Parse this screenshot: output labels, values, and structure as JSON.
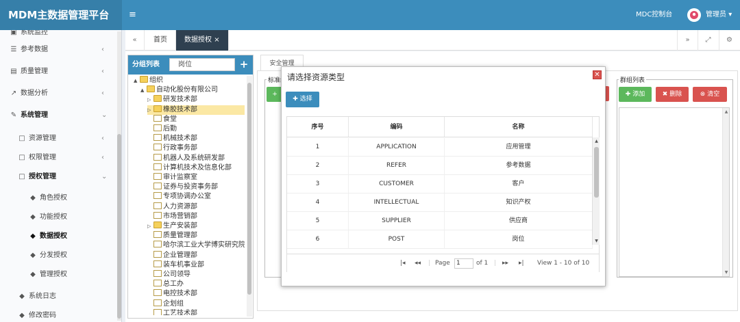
{
  "app": {
    "title": "MDM主数据管理平台",
    "menu_toggle_icon": "bars-icon"
  },
  "header": {
    "console_link": "MDC控制台",
    "user_name": "管理员",
    "user_caret": "▾"
  },
  "sidebar": {
    "items": [
      {
        "label": "参考数据",
        "icon": "list-icon"
      },
      {
        "label": "质量管理",
        "icon": "list-alt-icon"
      },
      {
        "label": "数据分析",
        "icon": "line-chart-icon"
      },
      {
        "label": "系统管理",
        "icon": "wrench-icon"
      },
      {
        "label": "资源管理",
        "icon": "folder-icon"
      },
      {
        "label": "权限管理",
        "icon": "folder-icon"
      },
      {
        "label": "授权管理",
        "icon": "folder-icon"
      },
      {
        "label": "角色授权",
        "icon": "bookmark-icon"
      },
      {
        "label": "功能授权",
        "icon": "bookmark-icon"
      },
      {
        "label": "数据授权",
        "icon": "bookmark-icon"
      },
      {
        "label": "分发授权",
        "icon": "bookmark-icon"
      },
      {
        "label": "管理授权",
        "icon": "bookmark-icon"
      },
      {
        "label": "系统日志",
        "icon": "bookmark-icon"
      },
      {
        "label": "修改密码",
        "icon": "bookmark-icon"
      }
    ],
    "partial_top_label": "系统监控"
  },
  "tabs": {
    "home": "首页",
    "active": "数据授权",
    "close_glyph": "×"
  },
  "group_list": {
    "title": "分组列表",
    "search_value": "岗位",
    "add_glyph": "+"
  },
  "tree": [
    {
      "label": "组织",
      "level": 0,
      "type": "folder",
      "toggle": "▲"
    },
    {
      "label": "自动化股份有限公司",
      "level": 1,
      "type": "folder",
      "toggle": "▲"
    },
    {
      "label": "研发技术部",
      "level": 2,
      "type": "folder",
      "toggle": "▷"
    },
    {
      "label": "橡胶技术部",
      "level": 2,
      "type": "folder",
      "toggle": "▷",
      "selected": true
    },
    {
      "label": "食堂",
      "level": 2,
      "type": "doc"
    },
    {
      "label": "后勤",
      "level": 2,
      "type": "doc"
    },
    {
      "label": "机械技术部",
      "level": 2,
      "type": "doc"
    },
    {
      "label": "行政事务部",
      "level": 2,
      "type": "doc"
    },
    {
      "label": "机器人及系统研发部",
      "level": 2,
      "type": "doc"
    },
    {
      "label": "计算机技术及信息化部",
      "level": 2,
      "type": "doc"
    },
    {
      "label": "审计监察室",
      "level": 2,
      "type": "doc"
    },
    {
      "label": "证券与投资事务部",
      "level": 2,
      "type": "doc"
    },
    {
      "label": "专项协调办公室",
      "level": 2,
      "type": "doc"
    },
    {
      "label": "人力资源部",
      "level": 2,
      "type": "doc"
    },
    {
      "label": "市场营销部",
      "level": 2,
      "type": "doc"
    },
    {
      "label": "生产安装部",
      "level": 2,
      "type": "folder",
      "toggle": "▷"
    },
    {
      "label": "质量管理部",
      "level": 2,
      "type": "doc"
    },
    {
      "label": "哈尔滨工业大学博实研究院",
      "level": 2,
      "type": "doc"
    },
    {
      "label": "企业管理部",
      "level": 2,
      "type": "doc"
    },
    {
      "label": "装车机事业部",
      "level": 2,
      "type": "doc"
    },
    {
      "label": "公司领导",
      "level": 2,
      "type": "doc"
    },
    {
      "label": "总工办",
      "level": 2,
      "type": "doc"
    },
    {
      "label": "电控技术部",
      "level": 2,
      "type": "doc"
    },
    {
      "label": "企划组",
      "level": 2,
      "type": "doc"
    },
    {
      "label": "工艺技术部",
      "level": 2,
      "type": "doc"
    }
  ],
  "security": {
    "tab_label": "安全管理",
    "standard_legend": "标准组",
    "add_glyph": "+",
    "group_legend": "群组列表",
    "add_label": "添加",
    "delete_label": "删除",
    "clear_label": "清空"
  },
  "modal": {
    "title": "请选择资源类型",
    "select_label": "选择",
    "columns": [
      "序号",
      "编码",
      "名称"
    ],
    "rows": [
      {
        "no": "1",
        "code": "APPLICATION",
        "name": "应用管理"
      },
      {
        "no": "2",
        "code": "REFER",
        "name": "参考数据"
      },
      {
        "no": "3",
        "code": "CUSTOMER",
        "name": "客户"
      },
      {
        "no": "4",
        "code": "INTELLECTUAL",
        "name": "知识产权"
      },
      {
        "no": "5",
        "code": "SUPPLIER",
        "name": "供应商"
      },
      {
        "no": "6",
        "code": "POST",
        "name": "岗位"
      }
    ],
    "pager": {
      "page_label": "Page",
      "page_value": "1",
      "of_label": "of 1",
      "view_text": "View 1 - 10 of 10"
    }
  }
}
